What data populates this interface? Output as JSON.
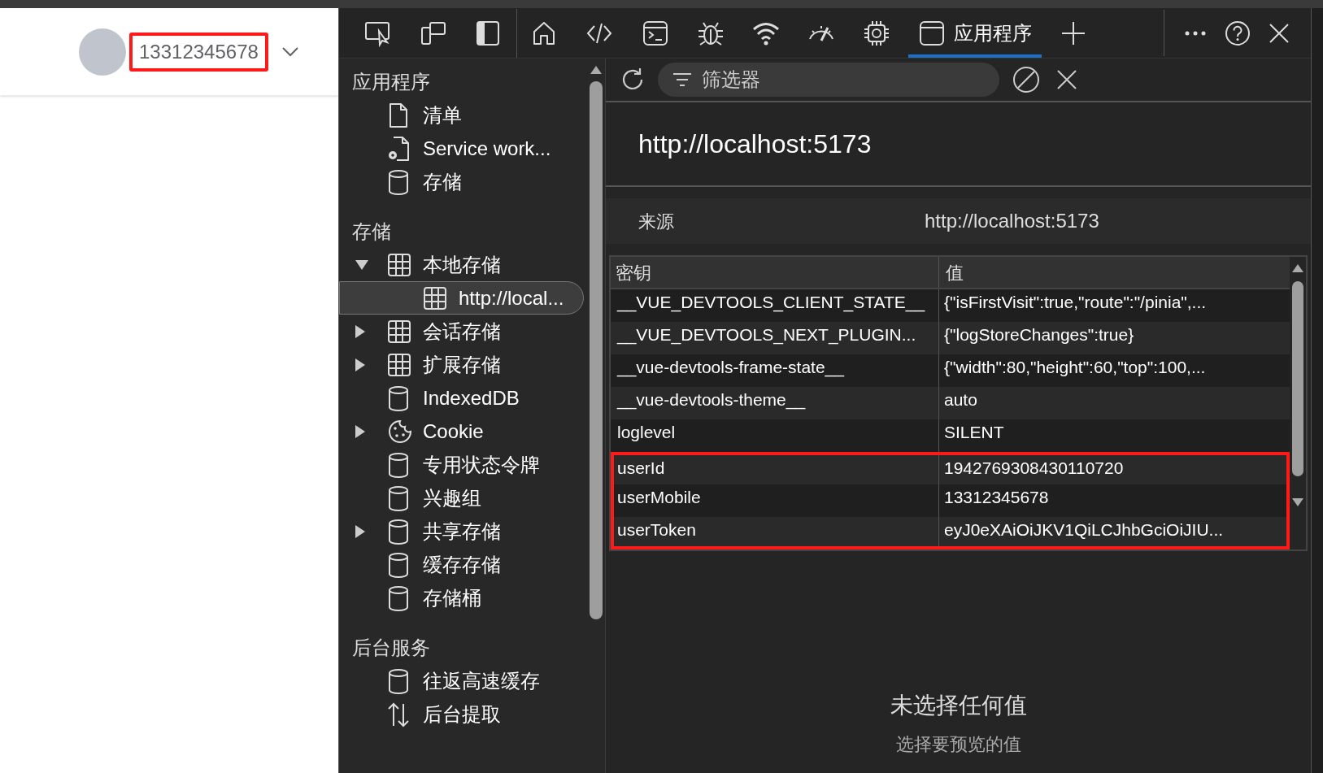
{
  "page_header": {
    "user_mobile": "13312345678",
    "highlighted": true
  },
  "devtools": {
    "toolbar": [
      {
        "kind": "inspect"
      },
      {
        "kind": "device"
      },
      {
        "kind": "dock"
      },
      {
        "kind": "divider"
      },
      {
        "kind": "home",
        "selected": false
      },
      {
        "kind": "code",
        "selected": false
      },
      {
        "kind": "console",
        "selected": false
      },
      {
        "kind": "bug",
        "selected": false
      },
      {
        "kind": "wifi",
        "selected": false
      },
      {
        "kind": "gauge",
        "selected": false
      },
      {
        "kind": "chip",
        "selected": false
      },
      {
        "kind": "app",
        "label": "应用程序",
        "selected": true
      },
      {
        "kind": "plus"
      }
    ],
    "sidebar": [
      {
        "heading": "应用程序",
        "items": [
          {
            "label": "清单",
            "kind": "file",
            "selected": false
          },
          {
            "label": "Service work...",
            "kind": "file-gear",
            "selected": false
          },
          {
            "label": "存储",
            "kind": "cylinder",
            "selected": false
          }
        ]
      },
      {
        "heading": "存储",
        "items": [
          {
            "label": "本地存储",
            "kind": "grid",
            "expanded": true,
            "selected": false,
            "children": [
              {
                "label": "http://local...",
                "kind": "grid",
                "selected": true
              }
            ]
          },
          {
            "label": "会话存储",
            "kind": "grid",
            "expanded": false,
            "selected": false
          },
          {
            "label": "扩展存储",
            "kind": "grid",
            "expanded": false,
            "selected": false
          },
          {
            "label": "IndexedDB",
            "kind": "cylinder",
            "selected": false
          },
          {
            "label": "Cookie",
            "kind": "cookie",
            "expanded": false,
            "selected": false
          },
          {
            "label": "专用状态令牌",
            "kind": "cylinder",
            "selected": false
          },
          {
            "label": "兴趣组",
            "kind": "cylinder",
            "selected": false
          },
          {
            "label": "共享存储",
            "kind": "cylinder",
            "expanded": false,
            "selected": false
          },
          {
            "label": "缓存存储",
            "kind": "cylinder",
            "selected": false
          },
          {
            "label": "存储桶",
            "kind": "cylinder",
            "selected": false
          }
        ]
      },
      {
        "heading": "后台服务",
        "items": [
          {
            "label": "往返高速缓存",
            "kind": "cylinder",
            "selected": false
          },
          {
            "label": "后台提取",
            "kind": "updown",
            "selected": false
          }
        ]
      }
    ],
    "filter": {
      "placeholder": "筛选器"
    },
    "origin_title": "http://localhost:5173",
    "origin_row": {
      "label": "来源",
      "value": "http://localhost:5173"
    },
    "table": {
      "columns": [
        "密钥",
        "值"
      ],
      "rows": [
        {
          "key": "__VUE_DEVTOOLS_CLIENT_STATE__",
          "value": "{\"isFirstVisit\":true,\"route\":\"/pinia\",...",
          "highlighted": false
        },
        {
          "key": "__VUE_DEVTOOLS_NEXT_PLUGIN...",
          "value": "{\"logStoreChanges\":true}",
          "highlighted": false
        },
        {
          "key": "__vue-devtools-frame-state__",
          "value": "{\"width\":80,\"height\":60,\"top\":100,...",
          "highlighted": false
        },
        {
          "key": "__vue-devtools-theme__",
          "value": "auto",
          "highlighted": false
        },
        {
          "key": "loglevel",
          "value": "SILENT",
          "highlighted": false
        },
        {
          "key": "userId",
          "value": "1942769308430110720",
          "highlighted": true
        },
        {
          "key": "userMobile",
          "value": "13312345678",
          "highlighted": true
        },
        {
          "key": "userToken",
          "value": "eyJ0eXAiOiJKV1QiLCJhbGciOiJIU...",
          "highlighted": true
        }
      ]
    },
    "empty_state": {
      "title": "未选择任何值",
      "hint": "选择要预览的值"
    }
  }
}
